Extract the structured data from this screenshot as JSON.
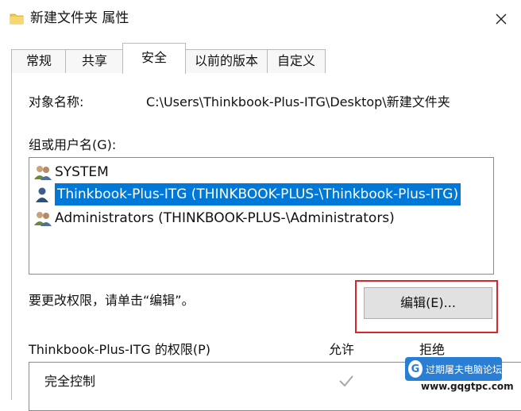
{
  "window": {
    "title": "新建文件夹 属性",
    "close_glyph": "✕"
  },
  "tabs": [
    {
      "label": "常规"
    },
    {
      "label": "共享"
    },
    {
      "label": "安全"
    },
    {
      "label": "以前的版本"
    },
    {
      "label": "自定义"
    }
  ],
  "active_tab": "安全",
  "object": {
    "label": "对象名称:",
    "value": "C:\\Users\\Thinkbook-Plus-ITG\\Desktop\\新建文件夹"
  },
  "groups": {
    "label": "组或用户名(G):",
    "items": [
      {
        "name": "SYSTEM",
        "icon": "users-group-icon",
        "selected": false
      },
      {
        "name": "Thinkbook-Plus-ITG (THINKBOOK-PLUS-\\Thinkbook-Plus-ITG)",
        "icon": "user-icon",
        "selected": true
      },
      {
        "name": "Administrators (THINKBOOK-PLUS-\\Administrators)",
        "icon": "users-group-icon",
        "selected": false
      }
    ]
  },
  "edit_hint": "要更改权限，请单击“编辑”。",
  "edit_button": "编辑(E)...",
  "permissions": {
    "label": "Thinkbook-Plus-ITG 的权限(P)",
    "allow_header": "允许",
    "deny_header": "拒绝",
    "rows": [
      {
        "name": "完全控制",
        "allow": true,
        "deny": false
      }
    ]
  },
  "watermark": {
    "text": "过期屠夫电脑论坛",
    "url": "www.gqgtpc.com"
  },
  "colors": {
    "selection": "#0078d7",
    "highlight_border": "#d9262c",
    "folder": "#f2c94c"
  }
}
